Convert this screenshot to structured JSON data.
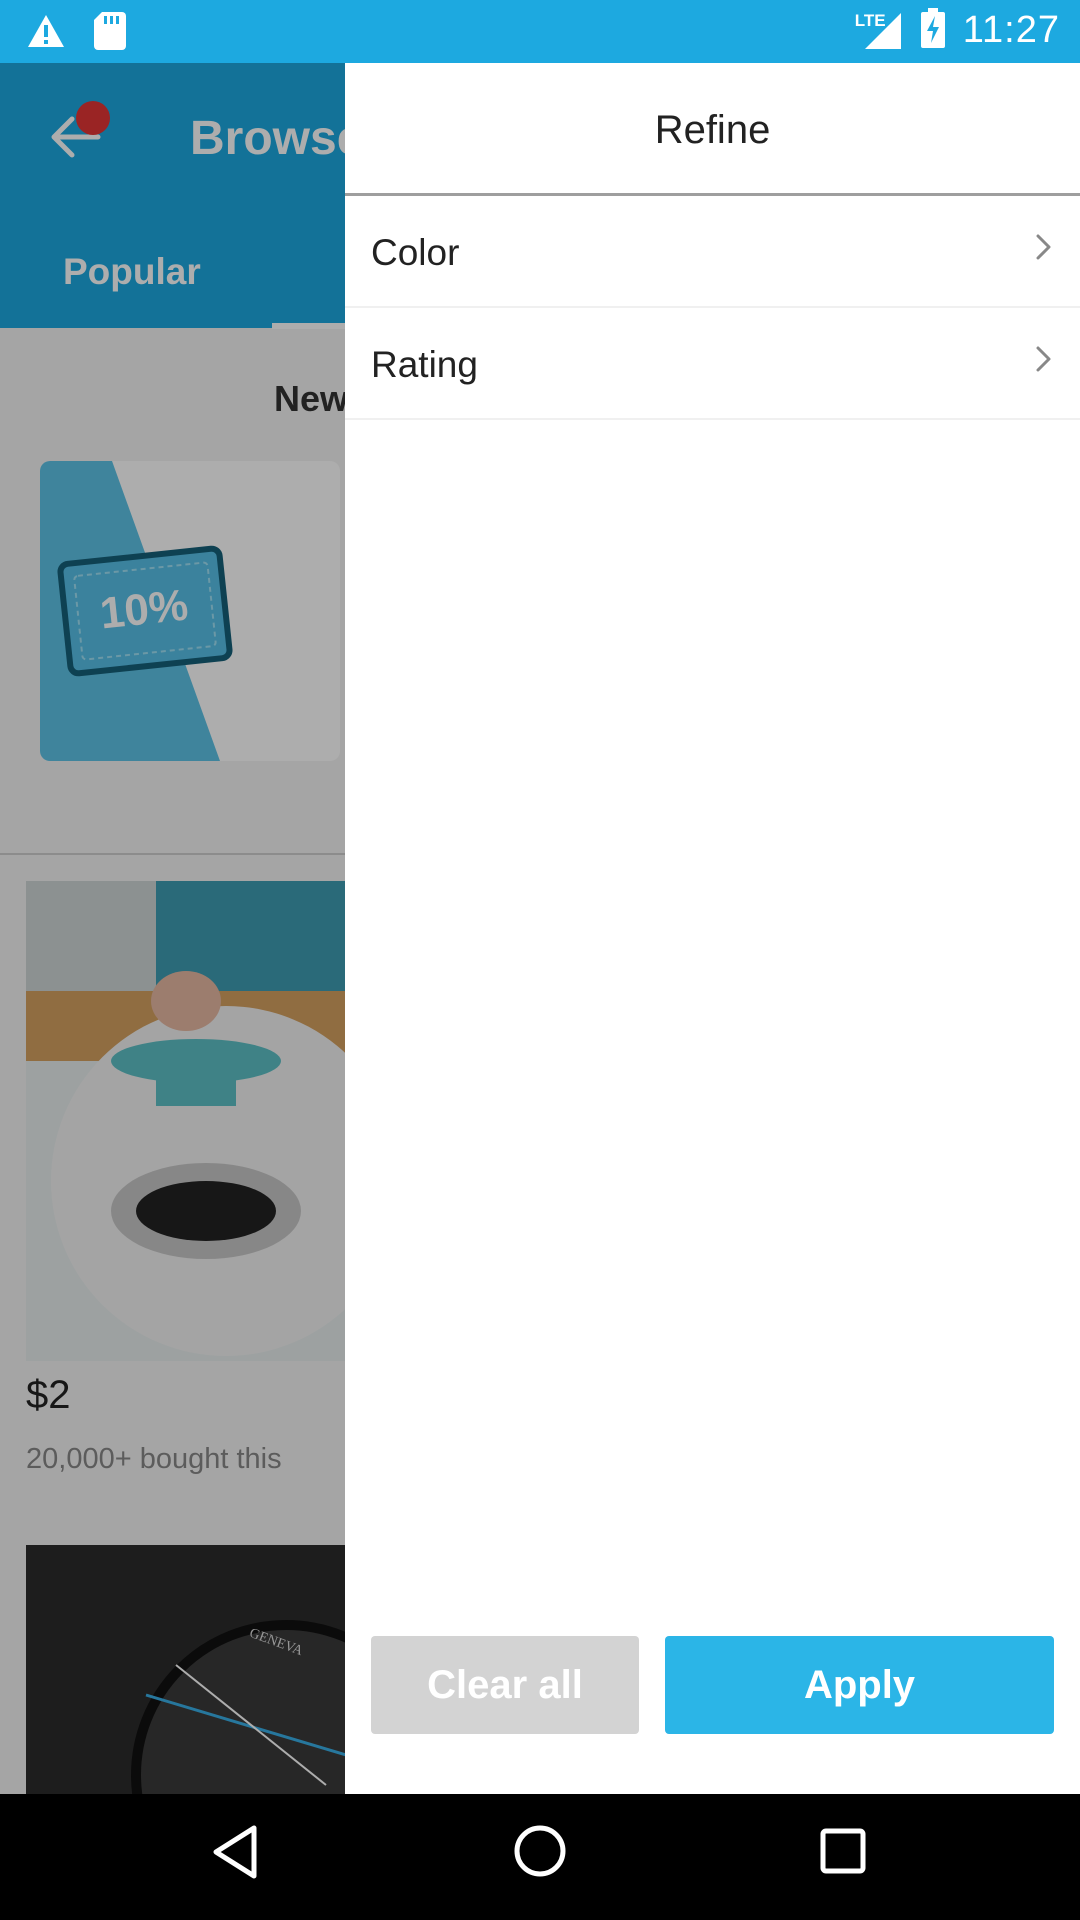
{
  "status_bar": {
    "time": "11:27",
    "network": "LTE",
    "icons": [
      "warning-icon",
      "sd-card-icon",
      "signal-icon",
      "battery-charging-icon"
    ]
  },
  "background": {
    "title": "Browse",
    "tab": "Popular",
    "section": "New",
    "promo_text": "10%",
    "price": "$2",
    "bought": "20,000+ bought this",
    "watch_brand": "GENEVA"
  },
  "drawer": {
    "title": "Refine",
    "items": [
      {
        "label": "Color"
      },
      {
        "label": "Rating"
      }
    ],
    "clear_label": "Clear all",
    "apply_label": "Apply"
  },
  "colors": {
    "brand": "#1da9e0",
    "apply": "#2bb5e7",
    "clear": "#d3d3d3"
  }
}
